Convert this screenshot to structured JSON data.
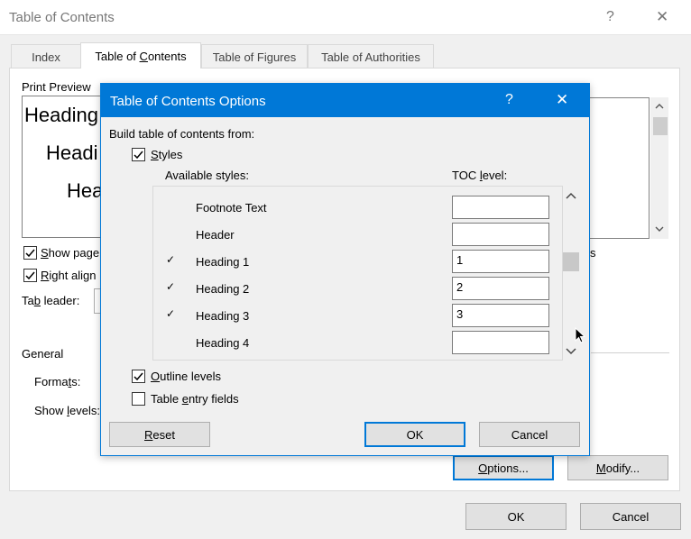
{
  "outer": {
    "title": "Table of Contents",
    "help": "?",
    "close": "✕",
    "tabs": [
      "Index",
      "Table of Contents",
      "Table of Figures",
      "Table of Authorities"
    ],
    "print_preview_label": "Print Preview",
    "preview_headings": [
      "Heading",
      "Headi",
      "Hea"
    ],
    "show_page_label": "Show page",
    "right_align_label": "Right align",
    "tab_leader_label": "Tab leader:",
    "general_label": "General",
    "formats_label": "Formats:",
    "show_levels_label": "Show levels:",
    "partial_right_text": "s",
    "options_button": "Options...",
    "modify_button": "Modify...",
    "ok_button": "OK",
    "cancel_button": "Cancel"
  },
  "dialog": {
    "title": "Table of Contents Options",
    "help": "?",
    "close": "✕",
    "build_label": "Build table of contents from:",
    "styles_label": "Styles",
    "available_styles_header": "Available styles:",
    "toc_level_header": "TOC level:",
    "rows": [
      {
        "style": "Footnote Text",
        "level": "",
        "checked": false
      },
      {
        "style": "Header",
        "level": "",
        "checked": false
      },
      {
        "style": "Heading 1",
        "level": "1",
        "checked": true
      },
      {
        "style": "Heading 2",
        "level": "2",
        "checked": true
      },
      {
        "style": "Heading 3",
        "level": "3",
        "checked": true
      },
      {
        "style": "Heading 4",
        "level": "",
        "checked": false
      }
    ],
    "outline_levels_label": "Outline levels",
    "table_entry_fields_label": "Table entry fields",
    "reset_button": "Reset",
    "ok_button": "OK",
    "cancel_button": "Cancel",
    "checkmark": "✓"
  },
  "colors": {
    "accent": "#0078d7",
    "dialog_title_bg": "#0078d7"
  }
}
